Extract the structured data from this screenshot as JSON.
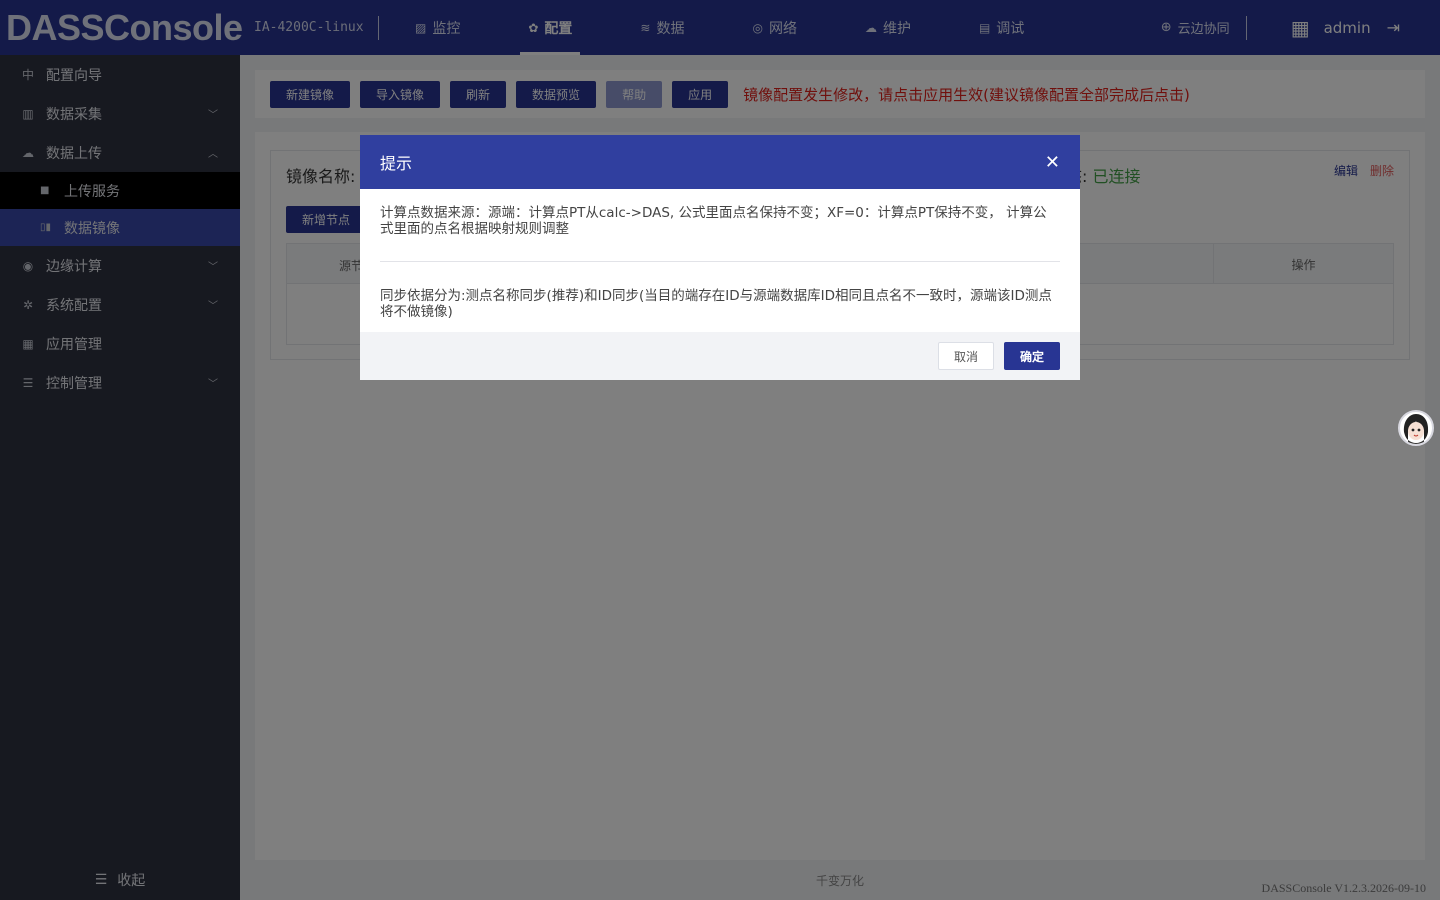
{
  "app": {
    "brand": "DASSConsole",
    "device": "IA-4200C-linux"
  },
  "nav": [
    {
      "label": "监控",
      "icon": "monitor-chart-icon",
      "active": false
    },
    {
      "label": "配置",
      "icon": "config-gear-icon",
      "active": true
    },
    {
      "label": "数据",
      "icon": "database-icon",
      "active": false
    },
    {
      "label": "网络",
      "icon": "network-icon",
      "active": false
    },
    {
      "label": "维护",
      "icon": "cloud-maintain-icon",
      "active": false
    },
    {
      "label": "调试",
      "icon": "debug-icon",
      "active": false
    }
  ],
  "header_right": {
    "cloud_label": "云边协同",
    "user": "admin"
  },
  "sidebar": {
    "items": [
      {
        "label": "配置向导",
        "icon": "wizard-icon"
      },
      {
        "label": "数据采集",
        "icon": "collect-icon"
      },
      {
        "label": "数据上传",
        "icon": "upload-cloud-icon"
      },
      {
        "label": "上传服务",
        "icon": "service-icon"
      },
      {
        "label": "数据镜像",
        "icon": "mirror-icon"
      },
      {
        "label": "边缘计算",
        "icon": "edge-compute-icon"
      },
      {
        "label": "系统配置",
        "icon": "system-config-icon"
      },
      {
        "label": "应用管理",
        "icon": "apps-grid-icon"
      },
      {
        "label": "控制管理",
        "icon": "sliders-icon"
      }
    ],
    "collapse_label": "收起"
  },
  "toolbar": {
    "buttons": [
      "新建镜像",
      "导入镜像",
      "刷新",
      "数据预览",
      "帮助",
      "应用"
    ],
    "warning": "镜像配置发生修改，请点击应用生效(建议镜像配置全部完成后点击)"
  },
  "card": {
    "name_label": "镜像名称:",
    "status_label": "态:",
    "status_value": "已连接",
    "edit": "编辑",
    "delete": "删除",
    "add_node": "新增节点",
    "col_source": "源节",
    "col_op": "操作"
  },
  "footer": {
    "company": "千变万化",
    "version": "DASSConsole V1.2.3.2026-09-10"
  },
  "modal": {
    "title": "提示",
    "para1": "计算点数据来源：源端：计算点PT从calc->DAS, 公式里面点名保持不变；XF=0：计算点PT保持不变， 计算公式里面的点名根据映射规则调整",
    "para2": "同步依据分为:测点名称同步(推荐)和ID同步(当目的端存在ID与源端数据库ID相同且点名不一致时，源端该ID测点将不做镜像)",
    "cancel": "取消",
    "ok": "确定"
  },
  "colors": {
    "primary": "#283593",
    "sidebar_bg": "#2f3341",
    "sidebar_active": "#3949ab",
    "warning": "#e0201b",
    "status_ok": "#43a047"
  }
}
